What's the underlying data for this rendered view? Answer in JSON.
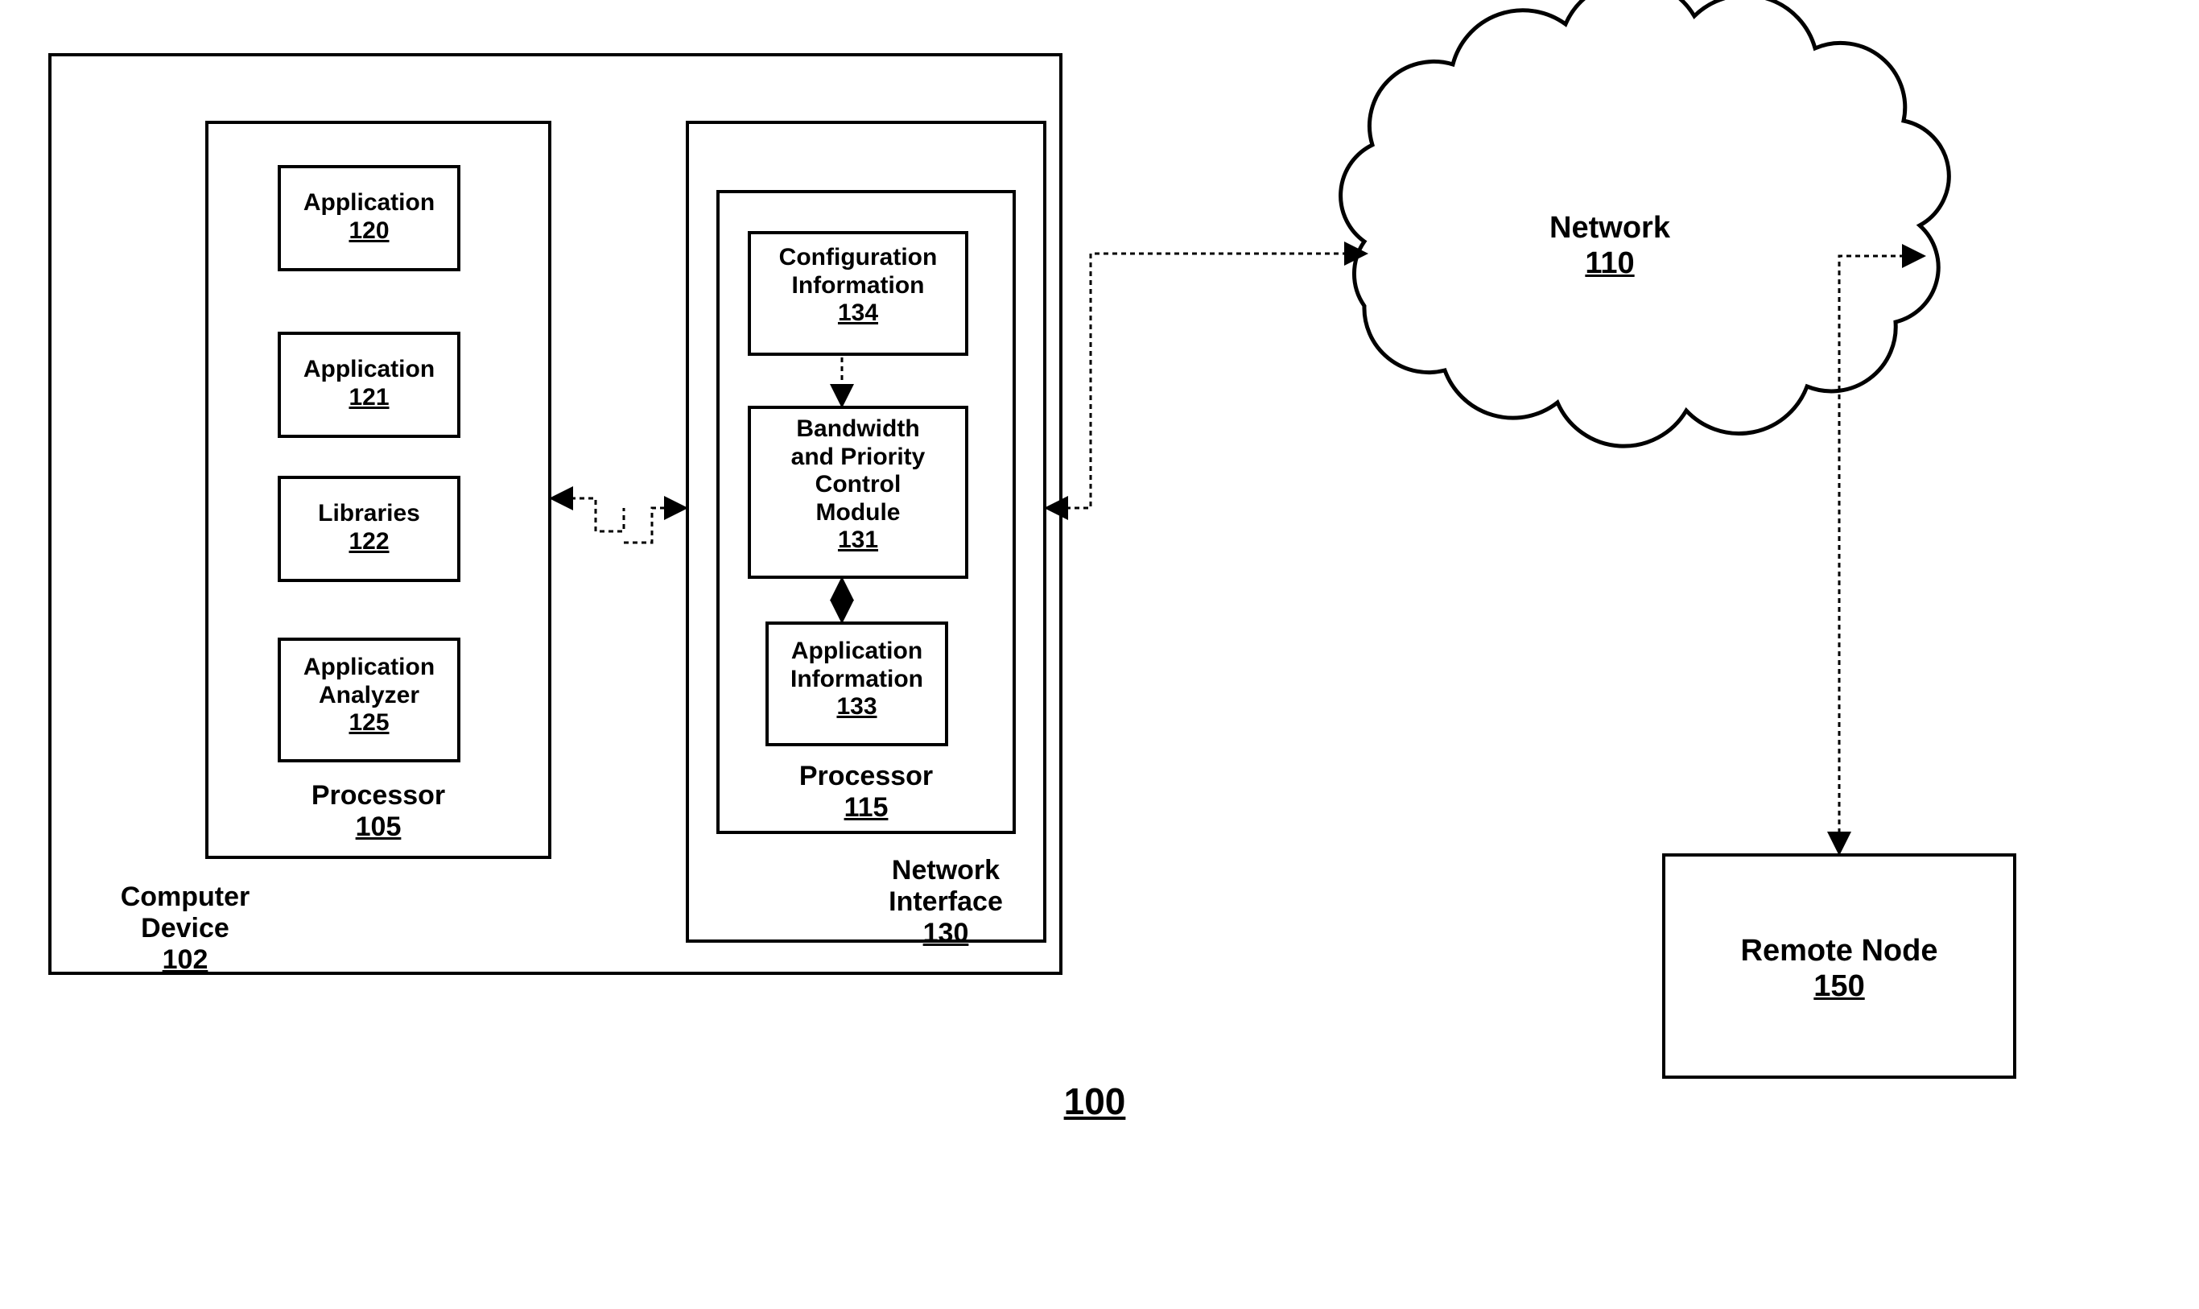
{
  "figure_ref": "100",
  "computer_device": {
    "label": "Computer\nDevice",
    "ref": "102",
    "processor": {
      "label": "Processor",
      "ref": "105",
      "app120": {
        "label": "Application",
        "ref": "120"
      },
      "app121": {
        "label": "Application",
        "ref": "121"
      },
      "libs": {
        "label": "Libraries",
        "ref": "122"
      },
      "analyzer": {
        "label": "Application\nAnalyzer",
        "ref": "125"
      }
    }
  },
  "network_interface": {
    "label": "Network\nInterface",
    "ref": "130",
    "processor": {
      "label": "Processor",
      "ref": "115",
      "config": {
        "label": "Configuration\nInformation",
        "ref": "134"
      },
      "bpc": {
        "label": "Bandwidth\nand Priority\nControl\nModule",
        "ref": "131"
      },
      "appinfo": {
        "label": "Application\nInformation",
        "ref": "133"
      }
    }
  },
  "network": {
    "label": "Network",
    "ref": "110"
  },
  "remote_node": {
    "label": "Remote Node",
    "ref": "150"
  }
}
